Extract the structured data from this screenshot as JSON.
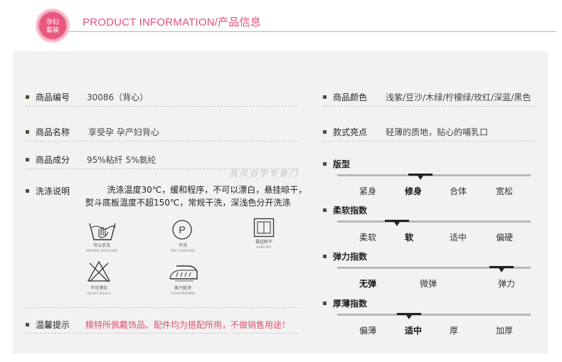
{
  "header": {
    "badge_line1": "孕妇",
    "badge_line2": "套装",
    "title": "PRODUCT INFORMATION/产品信息"
  },
  "left": {
    "code": {
      "label": "商品编号",
      "value": "30086（背心）"
    },
    "name": {
      "label": "商品名称",
      "value": "享受孕  孕产妇背心"
    },
    "material": {
      "label": "商品成分",
      "value": "95%粘纤  5%氨纶"
    },
    "wash": {
      "label": "洗涤说明",
      "text": "        洗涤温度30℃，缓和程序，不可以漂白，悬挂晾干，\n熨斗底板温度不超150℃，常规干洗，深浅色分开洗涤"
    },
    "care_icons": [
      {
        "icon": "hand-wash-icon",
        "cn": "可以手洗",
        "en": "WASHING WITH HAND"
      },
      {
        "icon": "dry-clean-icon",
        "cn": "干洗",
        "en": "DRY CLEAN ONLY"
      },
      {
        "icon": "hang-dry-icon",
        "cn": "悬挂晾干",
        "en": "HANG DRY"
      },
      {
        "icon": "no-bleach-icon",
        "cn": "不可漂白",
        "en": "DO NOT BLEACH"
      },
      {
        "icon": "steam-iron-icon",
        "cn": "蒸汽熨烫",
        "en": "STEAM PRESSING"
      }
    ],
    "tips": {
      "label": "温馨提示",
      "value": "模特所佩戴饰品、配件均为搭配所用，不做销售用途！"
    }
  },
  "right": {
    "color": {
      "label": "商品颜色",
      "value": "浅紫/豆沙/木绿/柠檬绿/玫红/深蓝/黑色"
    },
    "feature": {
      "label": "款式亮点",
      "value": "轻薄的质地，贴心的哺乳口"
    }
  },
  "scales": [
    {
      "title": "版型",
      "options": [
        "紧身",
        "修身",
        "合体",
        "宽松"
      ],
      "selected": 1,
      "marker_position": 0.43
    },
    {
      "title": "柔软指数",
      "options": [
        "柔软",
        "软",
        "适中",
        "偏硬"
      ],
      "selected": 1,
      "marker_position": 0.31
    },
    {
      "title": "弹力指数",
      "options": [
        "无弹",
        "微弹",
        "弹力"
      ],
      "selected": 0,
      "marker_position": 0.85
    },
    {
      "title": "厚薄指数",
      "options": [
        "偏薄",
        "适中",
        "厚",
        "加厚"
      ],
      "selected": 1,
      "marker_position": 0.37
    }
  ],
  "watermark": "我风自学专意门"
}
